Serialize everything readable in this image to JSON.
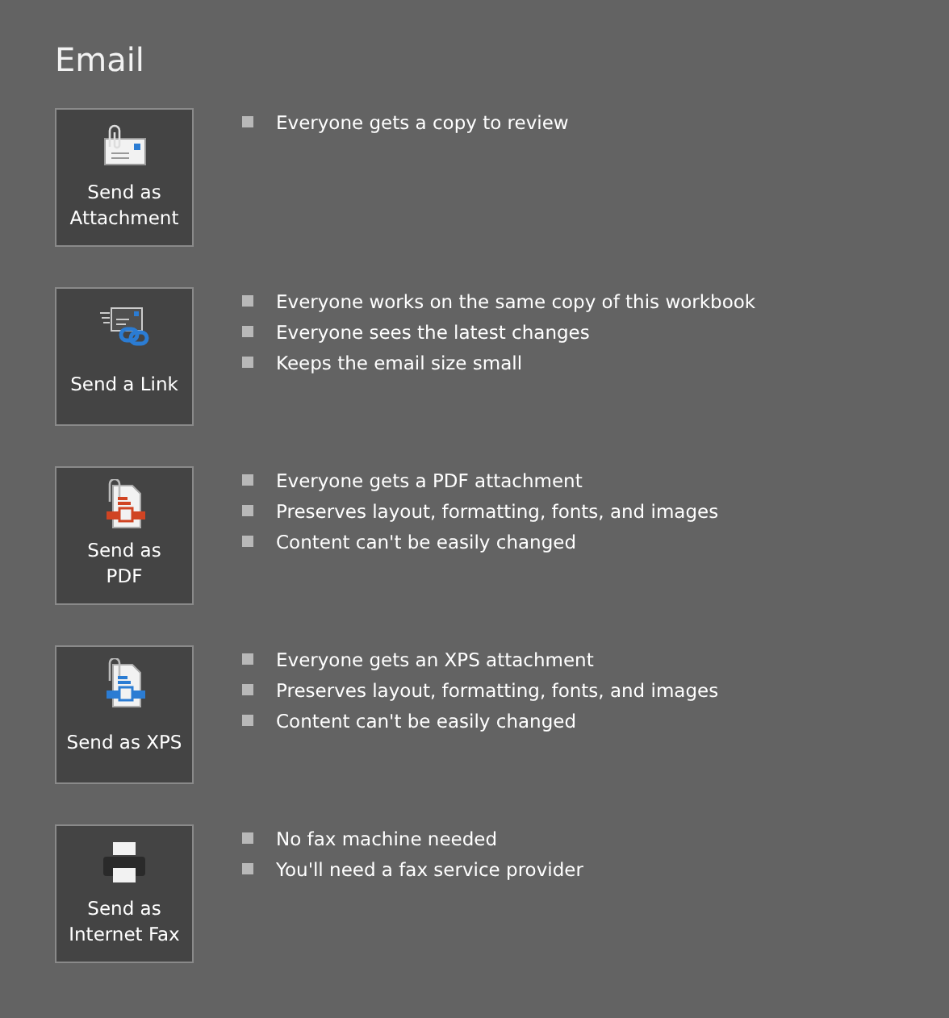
{
  "title": "Email",
  "options": [
    {
      "kind": "attachment",
      "label": "Send as\nAttachment",
      "bullets": [
        "Everyone gets a copy to review"
      ]
    },
    {
      "kind": "link",
      "label": "Send a Link",
      "bullets": [
        "Everyone works on the same copy of this workbook",
        "Everyone sees the latest changes",
        "Keeps the email size small"
      ]
    },
    {
      "kind": "pdf",
      "label": "Send as\nPDF",
      "bullets": [
        "Everyone gets a PDF attachment",
        "Preserves layout, formatting, fonts, and images",
        "Content can't be easily changed"
      ]
    },
    {
      "kind": "xps",
      "label": "Send as XPS",
      "bullets": [
        "Everyone gets an XPS attachment",
        "Preserves layout, formatting, fonts, and images",
        "Content can't be easily changed"
      ]
    },
    {
      "kind": "fax",
      "label": "Send as\nInternet Fax",
      "bullets": [
        "No fax machine needed",
        "You'll need a fax service provider"
      ]
    }
  ]
}
